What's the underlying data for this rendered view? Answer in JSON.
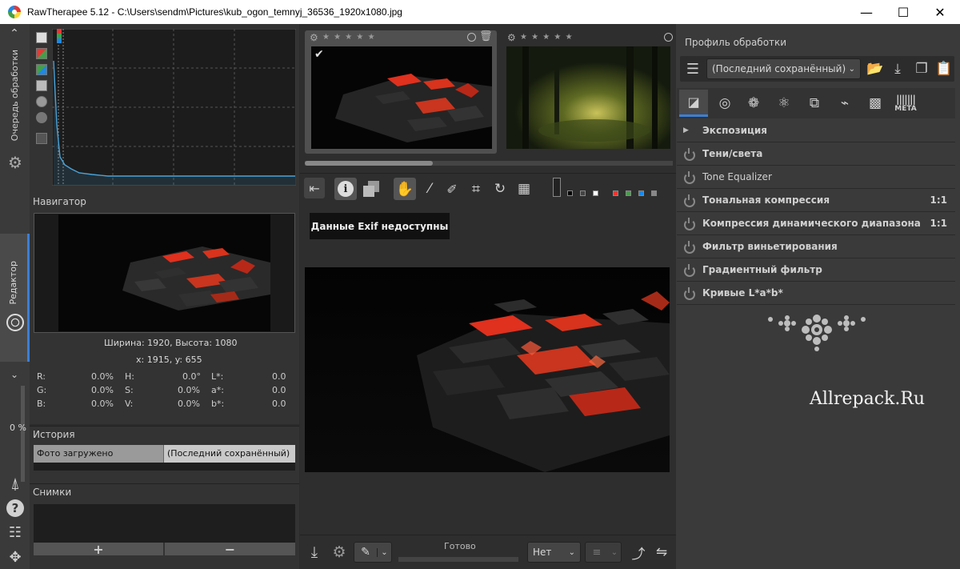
{
  "window": {
    "title": "RawTherapee 5.12 - C:\\Users\\sendm\\Pictures\\kub_ogon_temnyj_36536_1920x1080.jpg",
    "minimize_glyph": "—",
    "maximize_glyph": "☐",
    "close_glyph": "✕"
  },
  "left_strip": {
    "queue_label": "Очередь обработки",
    "editor_label": "Редактор",
    "percent": "0 %"
  },
  "navigator": {
    "title": "Навигатор",
    "size_text": "Ширина: 1920, Высота: 1080",
    "coords_text": "x: 1915, y: 655",
    "stats": [
      {
        "l1": "R:",
        "v1": "0.0%",
        "l2": "H:",
        "v2": "0.0°",
        "l3": "L*:",
        "v3": "0.0"
      },
      {
        "l1": "G:",
        "v1": "0.0%",
        "l2": "S:",
        "v2": "0.0%",
        "l3": "a*:",
        "v3": "0.0"
      },
      {
        "l1": "B:",
        "v1": "0.0%",
        "l2": "V:",
        "v2": "0.0%",
        "l3": "b*:",
        "v3": "0.0"
      }
    ]
  },
  "history": {
    "title": "История",
    "col1": "Фото загружено",
    "col2": "(Последний сохранённый)"
  },
  "snapshots": {
    "title": "Снимки",
    "add_glyph": "+",
    "remove_glyph": "−"
  },
  "filmstrip": {
    "stars": "★ ★ ★ ★ ★",
    "check_glyph": "✔"
  },
  "editor": {
    "exif_text": "Данные Exif недоступны",
    "status": "Готово",
    "zoom_select": "Нет"
  },
  "right_panel": {
    "profile_title": "Профиль обработки",
    "profile_value": "(Последний сохранённый)",
    "meta_tab": "META",
    "tools": [
      {
        "label": "Экспозиция",
        "ratio": "",
        "expanded": true
      },
      {
        "label": "Тени/света",
        "ratio": ""
      },
      {
        "label": "Tone Equalizer",
        "ratio": ""
      },
      {
        "label": "Тональная компрессия",
        "ratio": "1:1"
      },
      {
        "label": "Компрессия динамического диапазона",
        "ratio": "1:1"
      },
      {
        "label": "Фильтр виньетирования",
        "ratio": ""
      },
      {
        "label": "Градиентный фильтр",
        "ratio": ""
      },
      {
        "label": "Кривые L*a*b*",
        "ratio": ""
      }
    ],
    "watermark": "Allrepack.Ru"
  },
  "colors": {
    "accent_red": "#e53935",
    "histogram_line": "#4aa3d8",
    "panel_dark": "#1e1e1e"
  }
}
